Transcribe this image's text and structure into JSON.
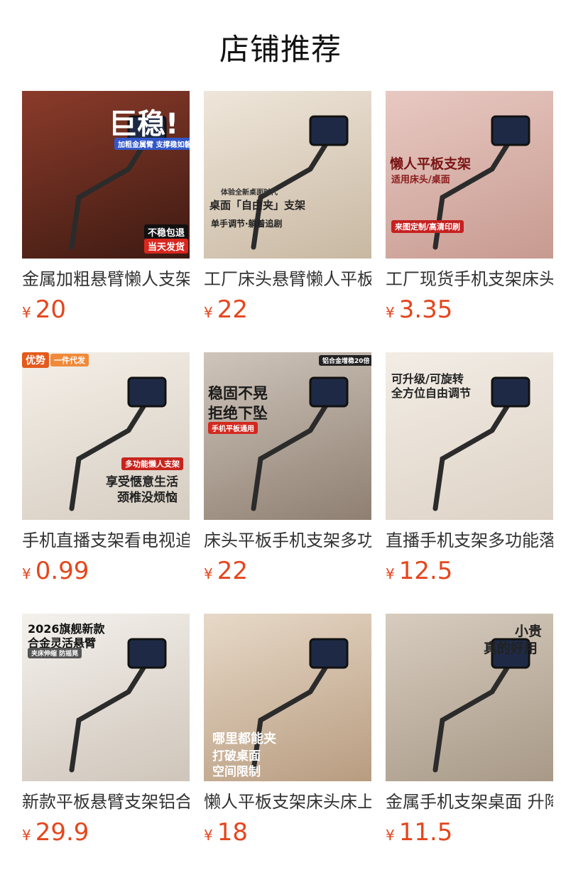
{
  "section_title": "店铺推荐",
  "currency": "¥",
  "products": [
    {
      "name": "金属加粗悬臂懒人支架",
      "price": "20",
      "image": {
        "bg": [
          "#8b3b2a",
          "#3d1a12"
        ],
        "texts": [
          "巨稳!",
          "加粗金属臂 支撑稳如磐石",
          "不稳包退",
          "当天发货"
        ]
      }
    },
    {
      "name": "工厂床头悬臂懒人平板支架",
      "price": "22",
      "image": {
        "bg": [
          "#efe6da",
          "#c8b8a2"
        ],
        "texts": [
          "桌面「自由夹」支架",
          "体验全新桌面时代",
          "单手调节·躺着追剧"
        ]
      }
    },
    {
      "name": "工厂现货手机支架床头",
      "price": "3.35",
      "image": {
        "bg": [
          "#e8c9c2",
          "#c79a90"
        ],
        "texts": [
          "懒人平板支架",
          "适用床头/桌面",
          "来图定制/高清印刷"
        ]
      }
    },
    {
      "name": "手机直播支架看电视追剧",
      "price": "0.99",
      "image": {
        "bg": [
          "#f4efe8",
          "#d6cdc1"
        ],
        "texts": [
          "优势",
          "一件代发",
          "多功能懒人支架",
          "享受惬意生活",
          "颈椎没烦恼"
        ]
      }
    },
    {
      "name": "床头平板手机支架多功能",
      "price": "22",
      "image": {
        "bg": [
          "#cfc5bb",
          "#8e7f71"
        ],
        "texts": [
          "稳固不晃",
          "拒绝下坠",
          "手机平板通用",
          "铝合金增稳20倍"
        ]
      }
    },
    {
      "name": "直播手机支架多功能落地",
      "price": "12.5",
      "image": {
        "bg": [
          "#f3ede6",
          "#ddd2c5"
        ],
        "texts": [
          "可升级/可旋转",
          "全方位自由调节"
        ]
      }
    },
    {
      "name": "新款平板悬臂支架铝合金",
      "price": "29.9",
      "image": {
        "bg": [
          "#f4f1ed",
          "#cfc5ba"
        ],
        "texts": [
          "2026旗舰新款",
          "合金灵活悬臂",
          "夹床伸缩 防摇晃"
        ]
      }
    },
    {
      "name": "懒人平板支架床头床上",
      "price": "18",
      "image": {
        "bg": [
          "#e7d9c8",
          "#b89c80"
        ],
        "texts": [
          "哪里都能夹",
          "打破桌面",
          "空间限制"
        ]
      }
    },
    {
      "name": "金属手机支架桌面 升降",
      "price": "11.5",
      "image": {
        "bg": [
          "#d7ccbf",
          "#a89987"
        ],
        "texts": [
          "小贵",
          "真的好用"
        ]
      }
    }
  ]
}
